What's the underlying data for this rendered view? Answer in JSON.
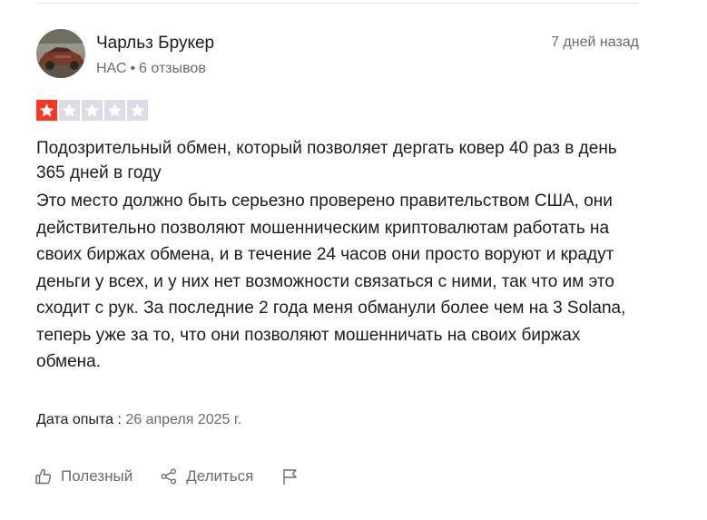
{
  "review": {
    "author": {
      "name": "Чарльз Брукер",
      "country": "НАС",
      "separator": "•",
      "reviews_count": "6 отзывов"
    },
    "date_ago": "7 дней назад",
    "rating": 1,
    "rating_max": 5,
    "colors": {
      "star_filled": "#ff3722",
      "star_empty": "#dcdce6",
      "text_primary": "#1c1c1c",
      "text_secondary": "#6b6b6b"
    },
    "title": "Подозрительный обмен, который позволяет дергать ковер 40 раз в день 365 дней в году",
    "body": "Это место должно быть серьезно проверено правительством США, они действительно позволяют мошенническим криптовалютам работать на своих биржах обмена, и в течение 24 часов они просто воруют и крадут деньги у всех, и у них нет возможности связаться с ними, так что им это сходит с рук. За последние 2 года меня обманули более чем на 3 Solana, теперь уже за то, что они позволяют мошенничать на своих биржах обмена.",
    "experience_label": "Дата опыта :",
    "experience_date": "26 апреля 2025 г."
  },
  "actions": {
    "useful_label": "Полезный",
    "share_label": "Делиться",
    "useful_icon": "thumbs-up-icon",
    "share_icon": "share-icon",
    "flag_icon": "flag-icon"
  }
}
